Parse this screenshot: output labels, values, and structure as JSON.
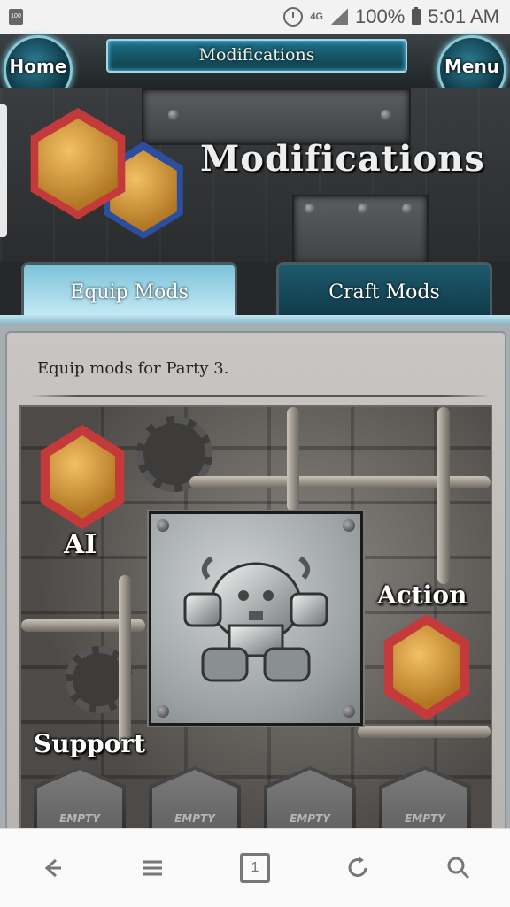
{
  "status_bar": {
    "notif_label": "100",
    "network": "4G",
    "battery": "100%",
    "time": "5:01 AM"
  },
  "header": {
    "title": "Modifications",
    "home_label": "Home",
    "menu_label": "Menu"
  },
  "banner": {
    "title": "Modifications"
  },
  "tabs": [
    {
      "label": "Equip Mods",
      "active": true
    },
    {
      "label": "Craft Mods",
      "active": false
    }
  ],
  "description": "Equip mods for Party 3.",
  "slots": {
    "ai_label": "AI",
    "action_label": "Action",
    "support_label": "Support",
    "support_slots": [
      "EMPTY",
      "EMPTY",
      "EMPTY",
      "EMPTY"
    ]
  },
  "nav": {
    "tab_count": "1"
  },
  "colors": {
    "accent_cyan": "#7bc2da",
    "dark_teal": "#0f3846",
    "gold": "#d79a3a",
    "red_frame": "#c43a3a"
  }
}
